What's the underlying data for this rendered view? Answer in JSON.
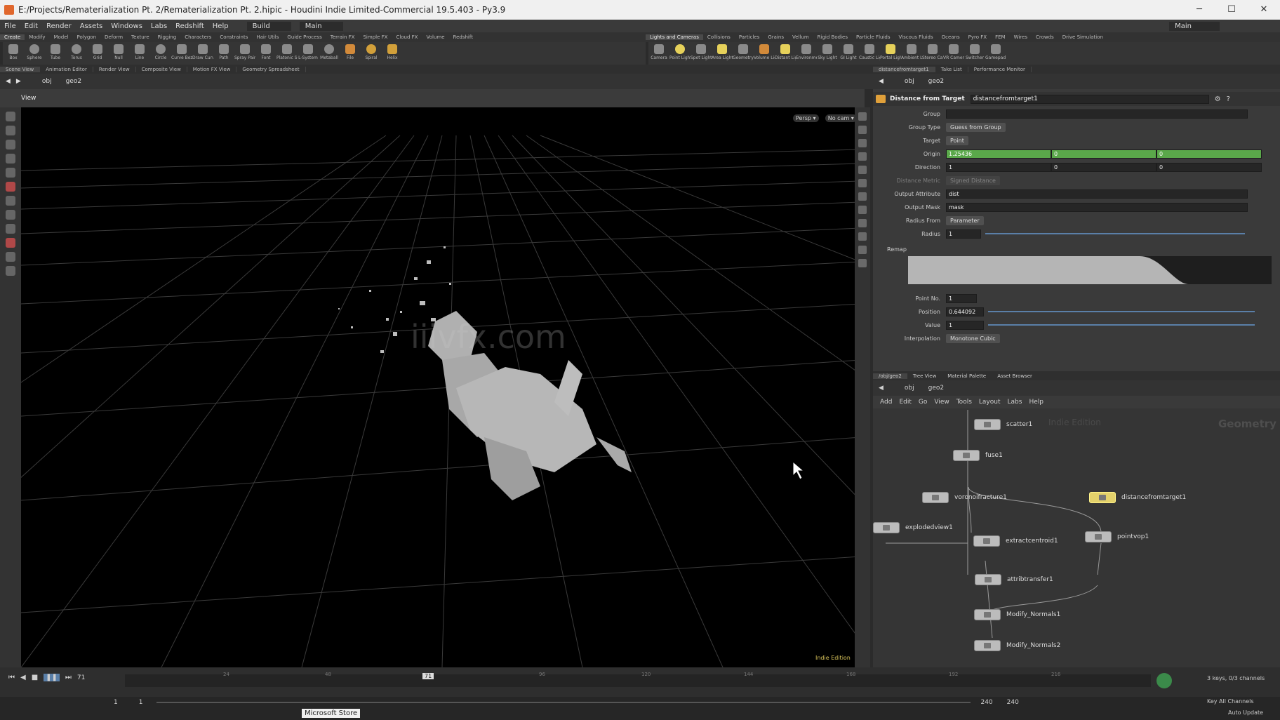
{
  "window": {
    "title": "E:/Projects/Rematerialization Pt. 2/Rematerialization Pt. 2.hipic - Houdini Indie Limited-Commercial 19.5.403 - Py3.9",
    "min": "─",
    "max": "☐",
    "close": "✕"
  },
  "menu": [
    "File",
    "Edit",
    "Render",
    "Assets",
    "Windows",
    "Labs",
    "Redshift",
    "Help"
  ],
  "desktop": {
    "label": "Build",
    "main_label": "Main",
    "main_right": "Main"
  },
  "shelf_tabs_left": [
    "Create",
    "Modify",
    "Model",
    "Polygon",
    "Deform",
    "Texture",
    "Rigging",
    "Characters",
    "Constraints",
    "Hair Utils",
    "Guide Process",
    "Terrain FX",
    "Simple FX",
    "Cloud FX",
    "Volume",
    "Redshift"
  ],
  "shelf_tabs_right": [
    "Lights and Cameras",
    "Collisions",
    "Particles",
    "Grains",
    "Vellum",
    "Rigid Bodies",
    "Particle Fluids",
    "Viscous Fluids",
    "Oceans",
    "Pyro FX",
    "FEM",
    "Wires",
    "Crowds",
    "Drive Simulation"
  ],
  "tools_left": [
    "Box",
    "Sphere",
    "Tube",
    "Torus",
    "Grid",
    "Null",
    "Line",
    "Circle",
    "Curve Bezier",
    "Draw Curve",
    "Path",
    "Spray Paint",
    "Font",
    "Platonic Solids",
    "L-System",
    "Metaball",
    "File",
    "Spiral",
    "Helix"
  ],
  "tools_right": [
    "Camera",
    "Point Light",
    "Spot Light",
    "Area Light",
    "Geometry Light",
    "Volume Light",
    "Distant Light",
    "Environment Light",
    "Sky Light",
    "GI Light",
    "Caustic Light",
    "Portal Light",
    "Ambient Light",
    "Stereo Camera",
    "VR Camera",
    "Switcher",
    "Gamepad Camera"
  ],
  "left_pane_tabs": [
    "Scene View",
    "Animation Editor",
    "Render View",
    "Composite View",
    "Motion FX View",
    "Geometry Spreadsheet"
  ],
  "right_pane_tabs": [
    "distancefromtarget1",
    "Take List",
    "Performance Monitor"
  ],
  "path": {
    "obj": "obj",
    "geo": "geo2"
  },
  "viewport": {
    "label": "View",
    "persp": "Persp ▾",
    "cam": "No cam ▾",
    "edition": "Indie Edition",
    "watermark": "iiivfx.com"
  },
  "params": {
    "node_type": "Distance from Target",
    "node_name": "distancefromtarget1",
    "group_label": "Group",
    "group_type_label": "Group Type",
    "group_type_value": "Guess from Group",
    "target_label": "Target",
    "target_value": "Point",
    "origin_label": "Origin",
    "origin": [
      "1.25436",
      "0",
      "0"
    ],
    "direction_label": "Direction",
    "direction": [
      "1",
      "0",
      "0"
    ],
    "distance_metric_label": "Distance Metric",
    "distance_metric_value": "Signed Distance",
    "output_attr_label": "Output Attribute",
    "output_attr_value": "dist",
    "output_mask_label": "Output Mask",
    "output_mask_value": "mask",
    "radius_from_label": "Radius From",
    "radius_from_value": "Parameter",
    "radius_label": "Radius",
    "radius_value": "1",
    "remap_label": "Remap",
    "point_no_label": "Point No.",
    "point_no_value": "1",
    "position_label": "Position",
    "position_value": "0.644092",
    "value_label": "Value",
    "value_value": "1",
    "interp_label": "Interpolation",
    "interp_value": "Monotone Cubic"
  },
  "net_tabs": [
    "/obj/geo2",
    "Tree View",
    "Material Palette",
    "Asset Browser"
  ],
  "net_menu": [
    "Add",
    "Edit",
    "Go",
    "View",
    "Tools",
    "Layout",
    "Labs",
    "Help"
  ],
  "net_watermark": "Indie Edition",
  "net_context": "Geometry",
  "nodes": [
    "scatter1",
    "fuse1",
    "voronoifracture1",
    "distancefromtarget1",
    "explodedview1",
    "extractcentroid1",
    "pointvop1",
    "attribtransfer1",
    "Modify_Normals1",
    "Modify_Normals2"
  ],
  "timeline": {
    "frame": "71",
    "start": "1",
    "start2": "1",
    "end": "240",
    "end2": "240",
    "ticks": [
      "24",
      "48",
      "72",
      "96",
      "120",
      "144",
      "168",
      "192",
      "216"
    ],
    "keys": "3 keys, 0/3 channels",
    "key_all": "Key All Channels",
    "auto_update": "Auto Update"
  },
  "taskbar": {
    "store": "Microsoft Store"
  }
}
